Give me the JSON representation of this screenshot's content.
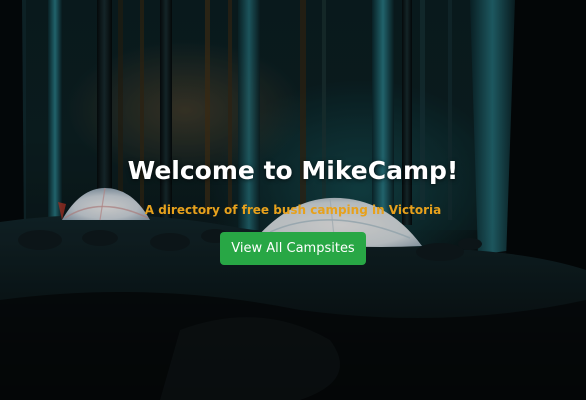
{
  "hero": {
    "title": "Welcome to MikeCamp!",
    "subtitle": "A directory of free bush camping in Victoria",
    "button_label": "View All Campsites"
  },
  "colors": {
    "title": "#ffffff",
    "subtitle": "#e7a11c",
    "button_bg": "#28a745",
    "button_text": "#ffffff"
  },
  "background": {
    "description_icon": "night-forest-campsite-photo"
  }
}
